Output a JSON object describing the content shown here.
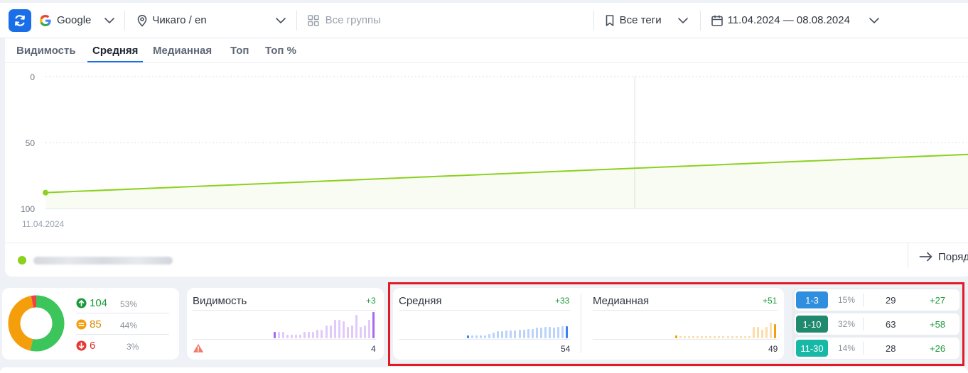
{
  "toolbar": {
    "search_engine": "Google",
    "location": "Чикаго / en",
    "groups_placeholder": "Все группы",
    "tags_label": "Все теги",
    "date_range": "11.04.2024 — 08.08.2024"
  },
  "tabs": [
    {
      "label": "Видимость",
      "active": false
    },
    {
      "label": "Средняя",
      "active": true
    },
    {
      "label": "Медианная",
      "active": false
    },
    {
      "label": "Топ",
      "active": false
    },
    {
      "label": "Топ %",
      "active": false
    }
  ],
  "chart_data": {
    "type": "area",
    "y_ticks": [
      "0",
      "50",
      "100"
    ],
    "ylim": [
      0,
      100
    ],
    "y_inverted": true,
    "x_labels": [
      "11.04.2024"
    ],
    "series": [
      {
        "x": [
          "11.04.2024",
          "08.08.2024"
        ],
        "y": [
          88,
          59
        ]
      }
    ],
    "color": "#8bd11e",
    "grid": true
  },
  "legend": {
    "series_color": "#8bd11e",
    "order_button": "Поряд"
  },
  "distribution": {
    "donut_colors": [
      "#3cc55a",
      "#f59e0b",
      "#ef4444"
    ],
    "rows": [
      {
        "count": "104",
        "pct": "53%",
        "color": "#1a9a3a"
      },
      {
        "count": "85",
        "pct": "44%",
        "color": "#d98a05"
      },
      {
        "count": "6",
        "pct": "3%",
        "color": "#d93030"
      }
    ]
  },
  "metrics": {
    "visibility": {
      "title": "Видимость",
      "delta": "+3",
      "value": "4",
      "color": "#a868f0"
    },
    "average": {
      "title": "Средняя",
      "delta": "+33",
      "value": "54",
      "color": "#3b82f6"
    },
    "median": {
      "title": "Медианная",
      "delta": "+51",
      "value": "49",
      "color": "#f59e0b"
    }
  },
  "ranges": [
    {
      "label": "1-3",
      "pct": "15%",
      "count": "29",
      "delta": "+27",
      "color": "#2f8fde"
    },
    {
      "label": "1-10",
      "pct": "32%",
      "count": "63",
      "delta": "+58",
      "color": "#1f8a6e"
    },
    {
      "label": "11-30",
      "pct": "14%",
      "count": "28",
      "delta": "+26",
      "color": "#17b8a6"
    }
  ]
}
